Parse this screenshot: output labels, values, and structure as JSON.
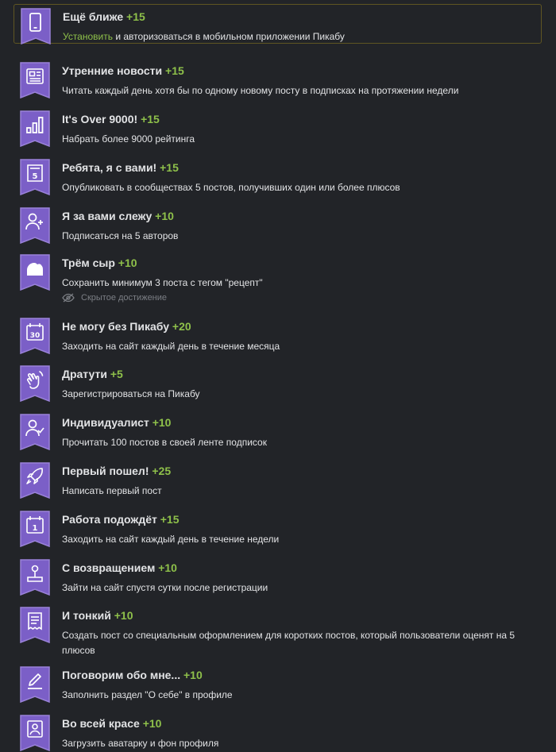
{
  "theme": {
    "badge_color": "#7b5fc7",
    "badge_border": "#9a82d9",
    "points_color": "#8ec04a",
    "background": "#222428"
  },
  "achievements": [
    {
      "title": "Ещё ближе",
      "points": "+15",
      "icon": "phone-icon",
      "desc_link": "Установить",
      "desc": " и авторизоваться в мобильном приложении Пикабу"
    },
    {
      "title": "Утренние новости",
      "points": "+15",
      "icon": "newspaper-icon",
      "desc": "Читать каждый день хотя бы по одному новому посту в подписках на протяжении недели"
    },
    {
      "title": "It's Over 9000!",
      "points": "+15",
      "icon": "bar-chart-icon",
      "desc": "Набрать более 9000 рейтинга"
    },
    {
      "title": "Ребята, я с вами!",
      "points": "+15",
      "icon": "document-five-icon",
      "desc": "Опубликовать в сообществах 5 постов, получивших один или более плюсов"
    },
    {
      "title": "Я за вами слежу",
      "points": "+10",
      "icon": "user-add-icon",
      "desc": "Подписаться на 5 авторов"
    },
    {
      "title": "Трём сыр",
      "points": "+10",
      "icon": "cheese-icon",
      "desc": "Сохранить минимум 3 поста с тегом \"рецепт\"",
      "hidden_label": "Скрытое достижение"
    },
    {
      "title": "Не могу без Пикабу",
      "points": "+20",
      "icon": "calendar-30-icon",
      "desc": "Заходить на сайт каждый день в течение месяца"
    },
    {
      "title": "Дратути",
      "points": "+5",
      "icon": "waving-hand-icon",
      "desc": "Зарегистрироваться на Пикабу"
    },
    {
      "title": "Индивидуалист",
      "points": "+10",
      "icon": "user-check-icon",
      "desc": "Прочитать 100 постов в своей ленте подписок"
    },
    {
      "title": "Первый пошел!",
      "points": "+25",
      "icon": "rocket-icon",
      "desc": "Написать первый пост"
    },
    {
      "title": "Работа подождёт",
      "points": "+15",
      "icon": "calendar-1-icon",
      "desc": "Заходить на сайт каждый день в течение недели"
    },
    {
      "title": "С возвращением",
      "points": "+10",
      "icon": "joystick-icon",
      "desc": "Зайти на сайт спустя сутки после регистрации"
    },
    {
      "title": "И тонкий",
      "points": "+10",
      "icon": "receipt-icon",
      "desc": "Создать пост со специальным оформлением для коротких постов, который пользователи оценят на 5 плюсов"
    },
    {
      "title": "Поговорим обо мне...",
      "points": "+10",
      "icon": "pencil-icon",
      "desc": "Заполнить раздел \"О себе\" в профиле"
    },
    {
      "title": "Во всей красе",
      "points": "+10",
      "icon": "profile-frame-icon",
      "desc": "Загрузить аватарку и фон профиля"
    }
  ]
}
